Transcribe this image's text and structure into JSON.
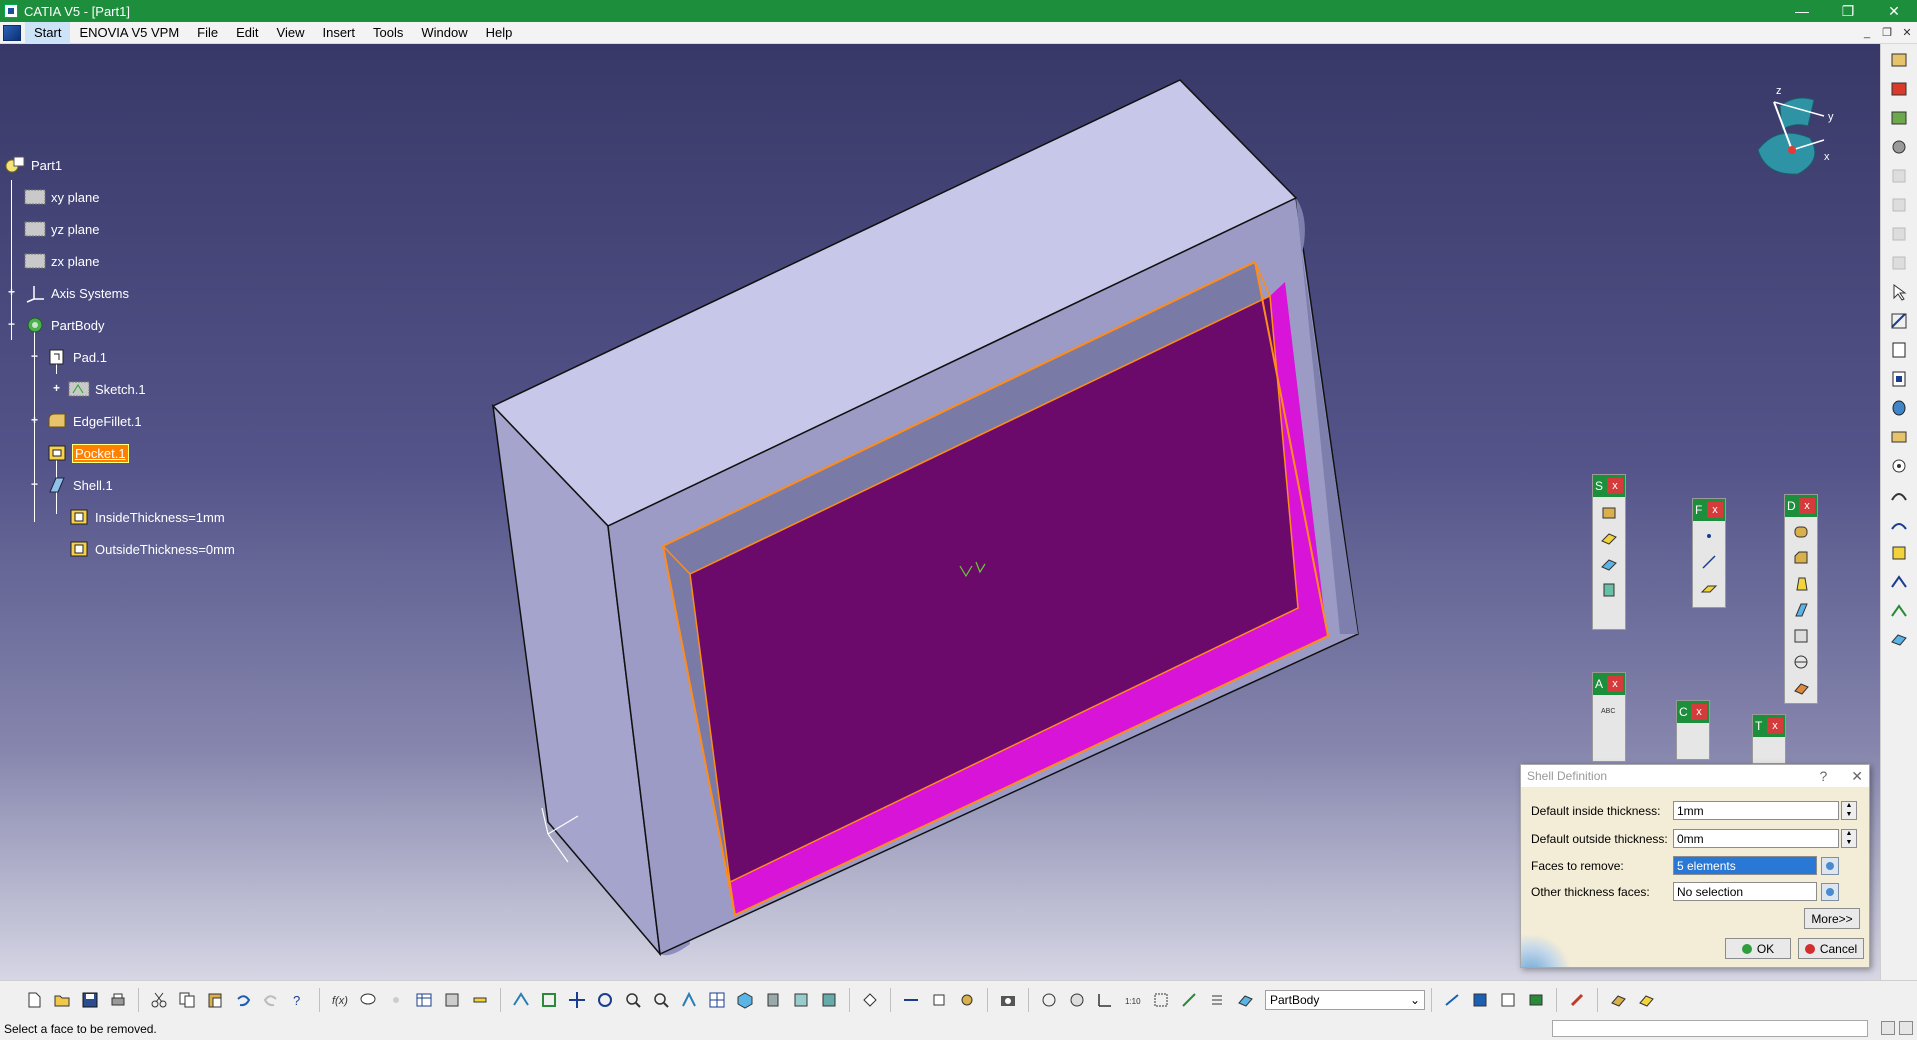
{
  "window": {
    "title": "CATIA V5 - [Part1]",
    "minimize": "—",
    "restore": "❐",
    "close": "✕"
  },
  "menu": [
    "Start",
    "ENOVIA V5 VPM",
    "File",
    "Edit",
    "View",
    "Insert",
    "Tools",
    "Window",
    "Help"
  ],
  "tree": {
    "part": "Part1",
    "xy": "xy plane",
    "yz": "yz plane",
    "zx": "zx plane",
    "axis": "Axis Systems",
    "body": "PartBody",
    "pad": "Pad.1",
    "sketch": "Sketch.1",
    "fillet": "EdgeFillet.1",
    "pocket": "Pocket.1",
    "shell": "Shell.1",
    "inside": "InsideThickness=1mm",
    "outside": "OutsideThickness=0mm"
  },
  "compass": {
    "z": "z",
    "y": "y",
    "x": "x"
  },
  "floating_toolbars": {
    "s": "S",
    "r": "F",
    "d": "D",
    "a": "A",
    "c": "C",
    "t": "T",
    "close": "x"
  },
  "dialog": {
    "title": "Shell Definition",
    "help": "?",
    "close": "✕",
    "inside_label": "Default inside thickness:",
    "inside_value": "1mm",
    "outside_label": "Default outside thickness:",
    "outside_value": "0mm",
    "faces_label": "Faces to remove:",
    "faces_value": "5 elements",
    "other_label": "Other thickness faces:",
    "other_value": "No selection",
    "more": "More>>",
    "ok": "OK",
    "cancel": "Cancel"
  },
  "bottom_toolbar": {
    "current_body": "PartBody"
  },
  "status": {
    "message": "Select a face to be removed."
  },
  "colors": {
    "titlebar": "#1d8f3c",
    "face_selected": "#6b0a6b",
    "face_magenta": "#d814d8",
    "edge_highlight": "#ff8c1a",
    "part_body": "#bcbce0",
    "tree_selected": "#ff8000"
  }
}
